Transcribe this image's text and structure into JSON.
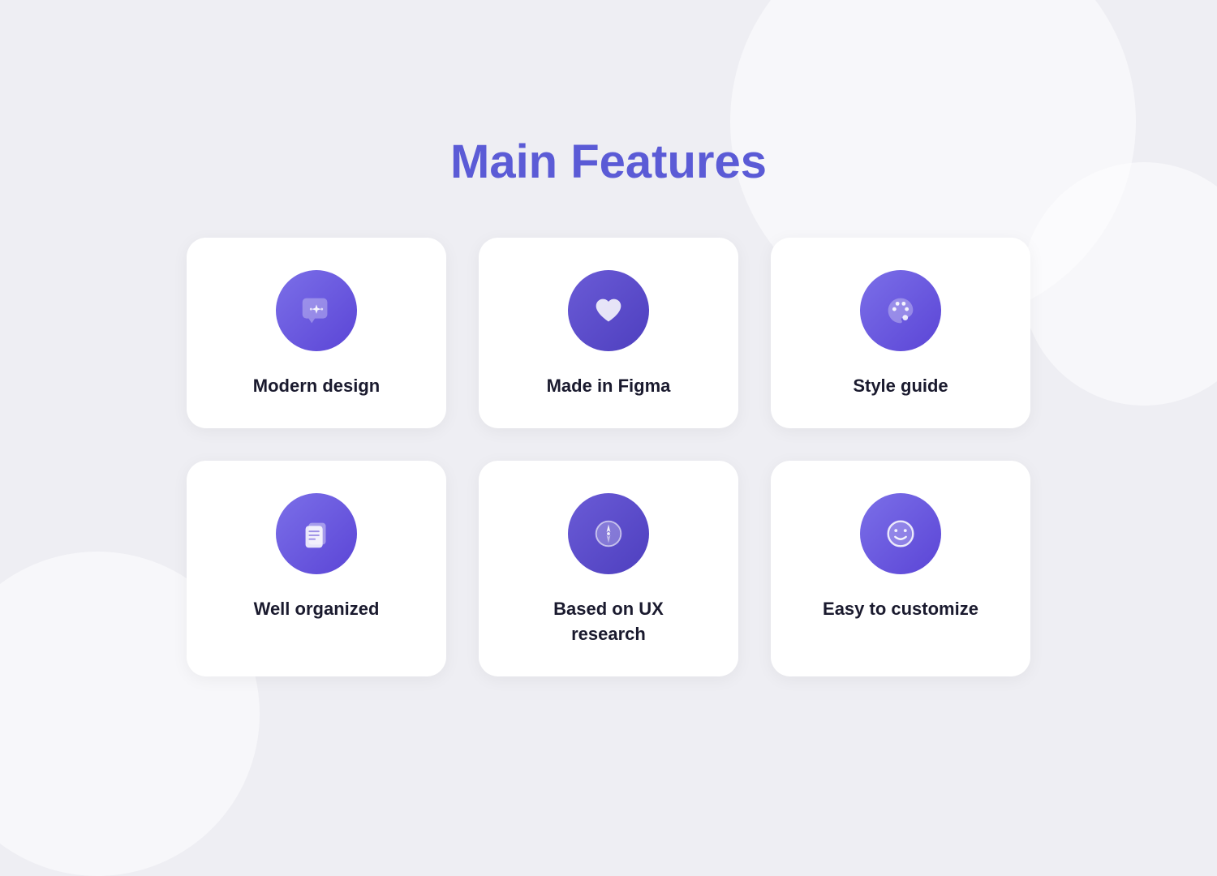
{
  "page": {
    "title": "Main Features",
    "background_color": "#eeeef3"
  },
  "features": [
    {
      "id": "modern-design",
      "label": "Modern design",
      "icon": "sparkle",
      "gradient": "gradient-1"
    },
    {
      "id": "made-in-figma",
      "label": "Made in Figma",
      "icon": "heart",
      "gradient": "gradient-2"
    },
    {
      "id": "style-guide",
      "label": "Style guide",
      "icon": "palette",
      "gradient": "gradient-1"
    },
    {
      "id": "well-organized",
      "label": "Well organized",
      "icon": "copy",
      "gradient": "gradient-1"
    },
    {
      "id": "ux-research",
      "label": "Based  on UX\nresearch",
      "icon": "compass",
      "gradient": "gradient-2"
    },
    {
      "id": "easy-to-customize",
      "label": "Easy to customize",
      "icon": "smile",
      "gradient": "gradient-1"
    }
  ]
}
